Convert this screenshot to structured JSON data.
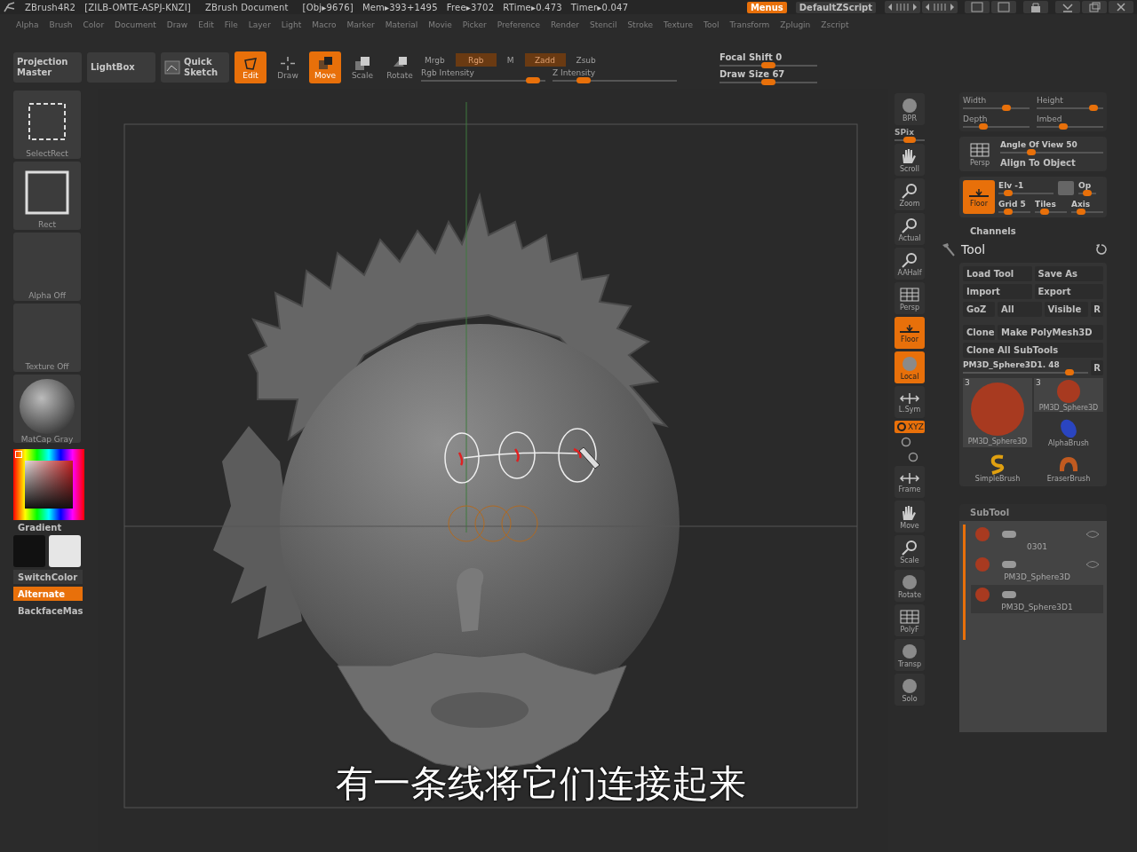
{
  "title_bar": {
    "app": "ZBrush4R2",
    "serial": "[ZILB-OMTE-ASPJ-KNZI]",
    "document": "ZBrush Document",
    "stats": [
      "[Obj▸9676]",
      "Mem▸393+1495",
      "Free▸3702",
      "RTime▸0.473",
      "Timer▸0.047"
    ],
    "menus": {
      "label": "Menus",
      "on": true
    },
    "script": "DefaultZScript"
  },
  "menu_bar": [
    "Alpha",
    "Brush",
    "Color",
    "Document",
    "Draw",
    "Edit",
    "File",
    "Layer",
    "Light",
    "Macro",
    "Marker",
    "Material",
    "Movie",
    "Picker",
    "Preference",
    "Render",
    "Stencil",
    "Stroke",
    "Texture",
    "Tool",
    "Transform",
    "Zplugin",
    "Zscript"
  ],
  "toolbar": {
    "panels": [
      "Projection Master",
      "LightBox",
      "Quick Sketch"
    ],
    "tools": [
      {
        "label": "Edit",
        "selected": true
      },
      {
        "label": "Draw",
        "selected": false
      },
      {
        "label": "Move",
        "selected": true
      },
      {
        "label": "Scale",
        "selected": false
      },
      {
        "label": "Rotate",
        "selected": false
      }
    ],
    "modes": [
      {
        "label": "Mrgb",
        "selected": false
      },
      {
        "label": "Rgb",
        "selected": true
      },
      {
        "label": "M",
        "selected": false
      },
      {
        "label": "Zadd",
        "selected": true
      },
      {
        "label": "Zsub",
        "selected": false
      }
    ],
    "intensity": [
      {
        "label": "Rgb Intensity",
        "level": 0.9
      },
      {
        "label": "Z Intensity",
        "level": 0.25
      }
    ],
    "sliders": [
      {
        "label": "Focal Shift 0",
        "level": 0.5
      },
      {
        "label": "Draw Size 67",
        "level": 0.5
      }
    ]
  },
  "left_shelf": {
    "items": [
      {
        "label": "SelectRect",
        "kind": "selectrect"
      },
      {
        "label": "Rect",
        "kind": "rect"
      },
      {
        "label": "Alpha Off",
        "kind": "blank"
      },
      {
        "label": "Texture Off",
        "kind": "blank"
      },
      {
        "label": "MatCap Gray",
        "kind": "matcap"
      }
    ],
    "gradient": "Gradient",
    "switch_color": "SwitchColor",
    "alternate": {
      "label": "Alternate",
      "on": true
    },
    "backface": "BackfaceMas"
  },
  "canvas": {
    "subtitle": "有一条线将它们连接起来"
  },
  "right_shelf": [
    {
      "label": "BPR",
      "kind": "sphere",
      "selected": false
    },
    {
      "label": "SPix",
      "kind": "slider",
      "level": 0.5
    },
    {
      "label": "Scroll",
      "kind": "hand",
      "selected": false
    },
    {
      "label": "Zoom",
      "kind": "magnifier",
      "selected": false
    },
    {
      "label": "Actual",
      "kind": "magnifier",
      "selected": false
    },
    {
      "label": "AAHalf",
      "kind": "magnifier",
      "selected": false
    },
    {
      "label": "Persp",
      "kind": "grid",
      "selected": false
    },
    {
      "label": "Floor",
      "kind": "floor",
      "selected": true
    },
    {
      "label": "Local",
      "kind": "sphere",
      "selected": true
    },
    {
      "label": "L.Sym",
      "kind": "arrows",
      "selected": false
    },
    {
      "label": "XYZ",
      "kind": "axis",
      "selected": true
    },
    {
      "label": "Frame",
      "kind": "arrows",
      "selected": false
    },
    {
      "label": "Move",
      "kind": "hand",
      "selected": false
    },
    {
      "label": "Scale",
      "kind": "magnifier",
      "selected": false
    },
    {
      "label": "Rotate",
      "kind": "sphere",
      "selected": false
    },
    {
      "label": "PolyF",
      "kind": "grid",
      "selected": false
    },
    {
      "label": "Transp",
      "kind": "sphere",
      "selected": false
    },
    {
      "label": "Solo",
      "kind": "sphere",
      "selected": false
    }
  ],
  "draw_panel": [
    {
      "label": "Width",
      "level": 0.65
    },
    {
      "label": "Height",
      "level": 0.85
    },
    {
      "label": "Depth",
      "level": 0.3
    },
    {
      "label": "Imbed",
      "level": 0.4
    }
  ],
  "view_panel": {
    "persp": "Persp",
    "angle": {
      "label": "Angle Of View 50",
      "level": 0.3
    },
    "align": "Align To Object"
  },
  "floor_panel": {
    "floor": {
      "label": "Floor",
      "on": true
    },
    "elv": {
      "label": "Elv -1",
      "level": 0.1
    },
    "op": {
      "label": "Op",
      "level": 0.5
    },
    "bottom": [
      {
        "label": "Grid 5",
        "level": 0.3
      },
      {
        "label": "Tiles",
        "level": 0.3
      },
      {
        "label": "Axis",
        "level": 0.3
      }
    ]
  },
  "channels": "Channels",
  "tool_palette": {
    "title": "Tool",
    "rows": [
      [
        "Load Tool",
        "Save As"
      ],
      [
        "Import",
        "Export"
      ],
      [
        "GoZ",
        "All",
        "Visible",
        "R"
      ],
      [
        "Clone",
        "Make PolyMesh3D"
      ],
      [
        "Clone All SubTools"
      ]
    ],
    "current": {
      "label": "PM3D_Sphere3D1. 48",
      "level": 0.85
    },
    "current_r": "R",
    "thumbs": [
      {
        "count": "3",
        "label": "PM3D_Sphere3D",
        "kind": "sphere"
      },
      {
        "count": "3",
        "label": "PM3D_Sphere3D",
        "kind": "small-sphere"
      },
      {
        "label": "AlphaBrush",
        "kind": "alpha"
      },
      {
        "label": "SimpleBrush",
        "kind": "simple"
      },
      {
        "label": "EraserBrush",
        "kind": "eraser"
      }
    ]
  },
  "subtool": {
    "title": "SubTool",
    "items": [
      {
        "label": "0301",
        "selected": false
      },
      {
        "label": "PM3D_Sphere3D",
        "selected": false
      },
      {
        "label": "PM3D_Sphere3D1",
        "selected": true
      }
    ]
  }
}
